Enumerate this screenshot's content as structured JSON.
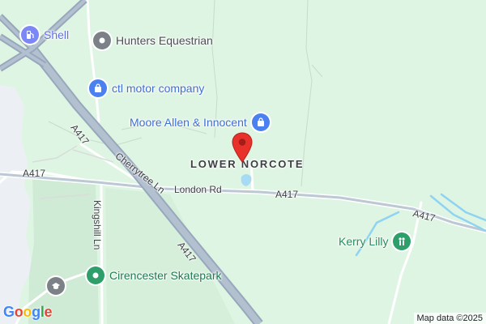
{
  "place_label": "LOWER NORCOTE",
  "attribution": "Map data ©2025",
  "logo": {
    "letters": [
      "G",
      "o",
      "o",
      "g",
      "l",
      "e"
    ],
    "colors": [
      "#4285F4",
      "#EA4335",
      "#FBBC05",
      "#4285F4",
      "#34A853",
      "#EA4335"
    ]
  },
  "pois": {
    "shell": {
      "label": "Shell",
      "icon": "fuel-pump-icon",
      "color": "#7b87f5",
      "label_color": "#5c6ff0"
    },
    "hunters_equestrian": {
      "label": "Hunters Equestrian",
      "icon": "generic-pin-icon",
      "color": "#7c8187",
      "label_color": "#4b4f54"
    },
    "ctl_motor_company": {
      "label": "ctl motor company",
      "icon": "shopping-bag-icon",
      "color": "#4a80f0",
      "label_color": "#3b6fd8"
    },
    "moore_allen_innocent": {
      "label": "Moore Allen & Innocent",
      "icon": "shopping-bag-icon",
      "color": "#4a80f0",
      "label_color": "#3b6fd8"
    },
    "kerry_lilly": {
      "label": "Kerry Lilly",
      "icon": "park-icon",
      "color": "#2e9e6a",
      "label_color": "#2b8a5d"
    },
    "cirencester_skatepark": {
      "label": "Cirencester Skatepark",
      "icon": "recreation-icon",
      "color": "#2e9e6a",
      "label_color": "#1e7a4f"
    },
    "school": {
      "icon": "school-icon",
      "color": "#7c8187"
    }
  },
  "roads": {
    "a417_west": "A417",
    "a417_diag_north": "A417",
    "a417_diag_south": "A417",
    "a417_east": "A417",
    "a417_far_east": "A417",
    "london_rd": "London Rd",
    "cherrytree_ln": "Cherrytree Ln",
    "kingshill_ln": "Kingshill Ln"
  },
  "colors": {
    "land": "#dff5e3",
    "urban": "#eef0f3",
    "field": "#cdebd4",
    "major_road": "#a7b5c6",
    "minor_road": "#ffffff",
    "water": "#8fd3f2",
    "marker": "#e8312a"
  }
}
